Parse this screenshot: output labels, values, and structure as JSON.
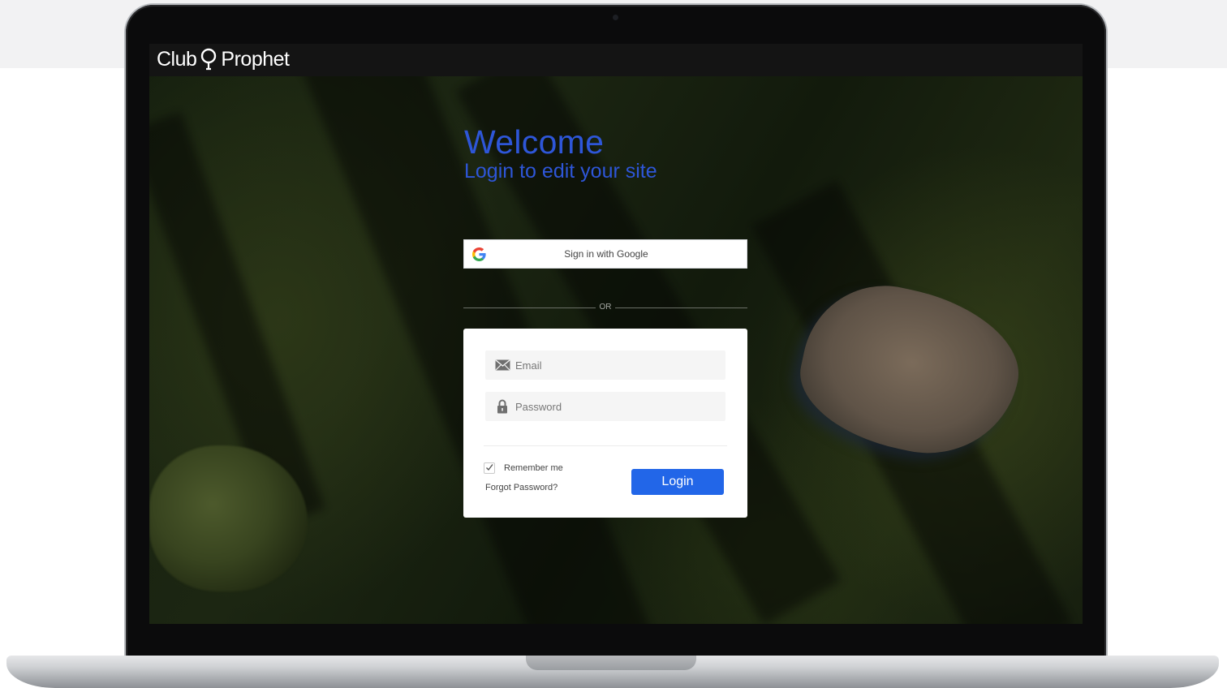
{
  "brand": {
    "name_left": "Club",
    "name_right": "Prophet"
  },
  "welcome": {
    "title": "Welcome",
    "subtitle": "Login to edit your site"
  },
  "google_signin": {
    "label": "Sign in with Google",
    "icon": "google-g-icon"
  },
  "divider": {
    "label": "OR"
  },
  "login_form": {
    "email": {
      "placeholder": "Email",
      "value": "",
      "icon": "envelope-icon"
    },
    "password": {
      "placeholder": "Password",
      "value": "",
      "icon": "lock-icon"
    },
    "remember_me": {
      "label": "Remember me",
      "checked": true
    },
    "forgot_password_label": "Forgot Password?",
    "login_label": "Login"
  },
  "colors": {
    "accent_blue": "#2266e8",
    "welcome_text": "#2e56d8",
    "header_bg": "#141414"
  }
}
